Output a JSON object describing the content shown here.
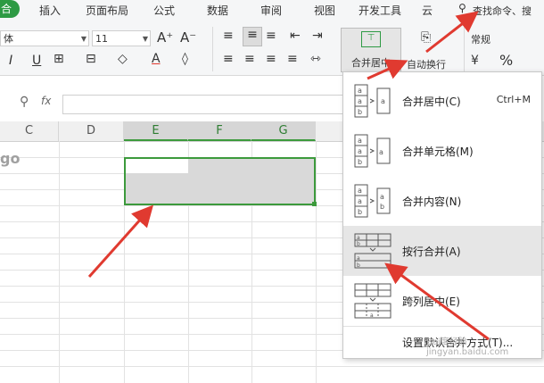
{
  "tabs": [
    "合",
    "插入",
    "页面布局",
    "公式",
    "数据",
    "审阅",
    "视图",
    "开发工具",
    "云"
  ],
  "search": {
    "label": "查找命令、搜"
  },
  "font": {
    "name_suffix": "体",
    "size": "11"
  },
  "number_format": "常规",
  "merge_button": {
    "label": "合并居中"
  },
  "wrap_text": {
    "label": "自动换行"
  },
  "formula_bar": {
    "fx": "fx",
    "value": ""
  },
  "columns": [
    "C",
    "D",
    "E",
    "F",
    "G"
  ],
  "logo_fragment": "go",
  "menu": {
    "items": [
      {
        "label": "合并居中(C)",
        "shortcut": "Ctrl+M"
      },
      {
        "label": "合并单元格(M)",
        "shortcut": ""
      },
      {
        "label": "合并内容(N)",
        "shortcut": ""
      },
      {
        "label": "按行合并(A)",
        "shortcut": ""
      },
      {
        "label": "跨列居中(E)",
        "shortcut": ""
      }
    ],
    "footer": "设置默认合并方式(T)..."
  },
  "watermark": "Bai度经验 jingyan.baidu.com",
  "colors": {
    "accent_green": "#2e9a44",
    "arrow_red": "#e03a30",
    "selection_border": "#3c9a3c"
  }
}
